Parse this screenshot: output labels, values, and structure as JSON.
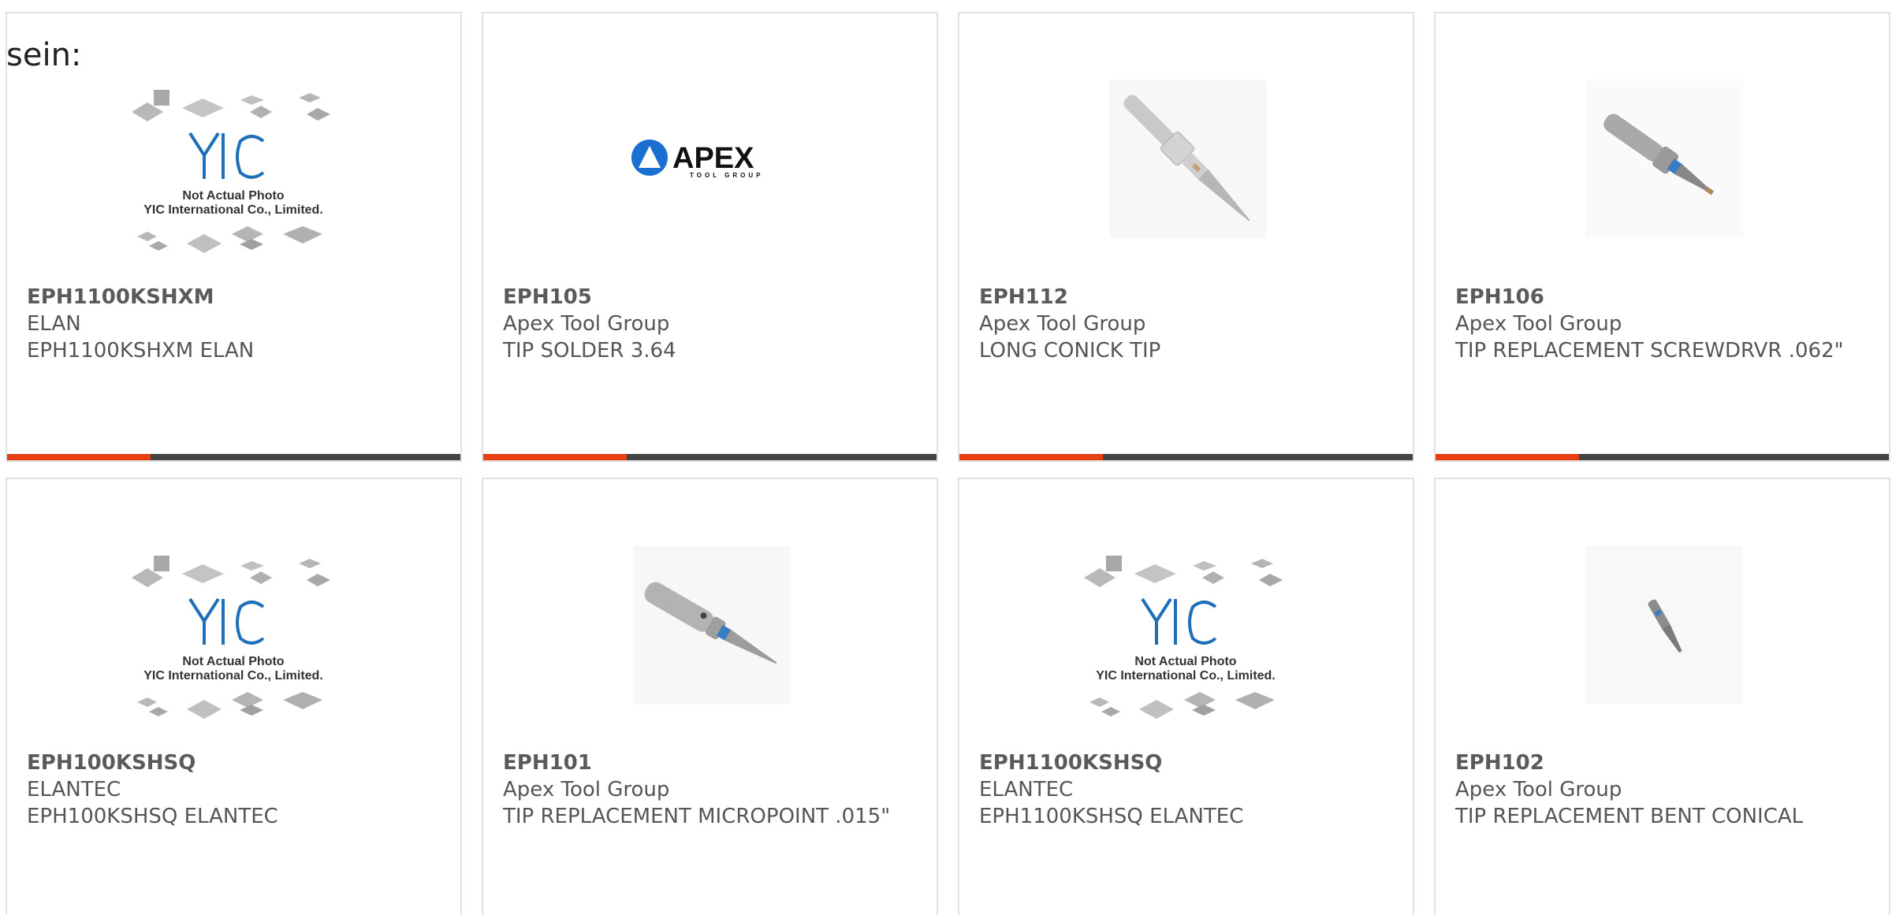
{
  "header_fragment": "sein:",
  "placeholder": {
    "line1": "Not Actual Photo",
    "line2": "YIC International Co., Limited."
  },
  "apex_logo": {
    "word": "APEX",
    "sub": "TOOL GROUP"
  },
  "colors": {
    "accent": "#e53f12",
    "bar": "#444444",
    "border": "#e2e2e2",
    "yic_blue": "#1e6fb8"
  },
  "products": [
    {
      "part": "EPH1100KSHXM",
      "maker": "ELAN",
      "desc": "EPH1100KSHXM ELAN",
      "image": "yic-placeholder"
    },
    {
      "part": "EPH105",
      "maker": "Apex Tool Group",
      "desc": "TIP SOLDER 3.64",
      "image": "apex-logo"
    },
    {
      "part": "EPH112",
      "maker": "Apex Tool Group",
      "desc": "LONG CONICK TIP",
      "image": "solder-tip-long"
    },
    {
      "part": "EPH106",
      "maker": "Apex Tool Group",
      "desc": "TIP REPLACEMENT SCREWDRVR .062\"",
      "image": "solder-tip-screwdriver"
    },
    {
      "part": "EPH100KSHSQ",
      "maker": "ELANTEC",
      "desc": "EPH100KSHSQ ELANTEC",
      "image": "yic-placeholder"
    },
    {
      "part": "EPH101",
      "maker": "Apex Tool Group",
      "desc": "TIP REPLACEMENT MICROPOINT .015\"",
      "image": "solder-tip-micropoint"
    },
    {
      "part": "EPH1100KSHSQ",
      "maker": "ELANTEC",
      "desc": "EPH1100KSHSQ ELANTEC",
      "image": "yic-placeholder"
    },
    {
      "part": "EPH102",
      "maker": "Apex Tool Group",
      "desc": "TIP REPLACEMENT BENT CONICAL",
      "image": "solder-tip-bent"
    }
  ]
}
